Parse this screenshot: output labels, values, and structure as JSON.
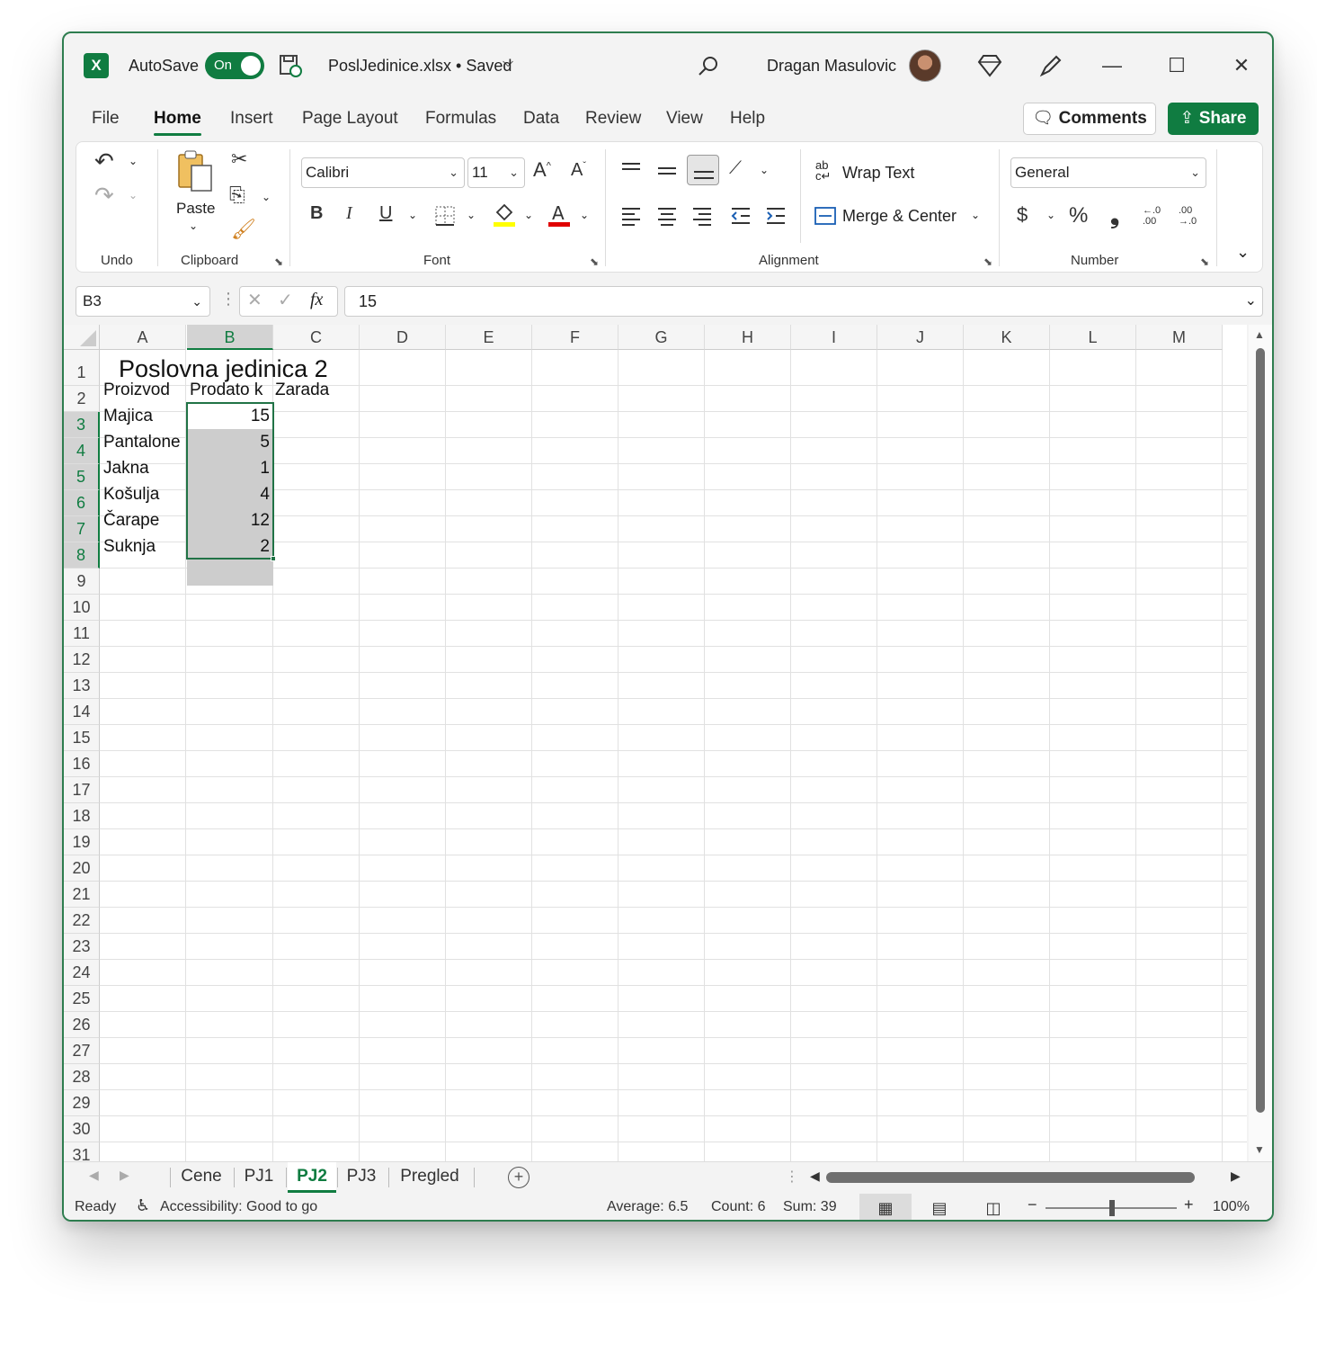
{
  "titlebar": {
    "autosave_label": "AutoSave",
    "autosave_state": "On",
    "file_title": "PoslJedinice.xlsx • Saved",
    "user_name": "Dragan Masulovic"
  },
  "menu": {
    "tabs": [
      "File",
      "Home",
      "Insert",
      "Page Layout",
      "Formulas",
      "Data",
      "Review",
      "View",
      "Help"
    ],
    "active": "Home",
    "comments_label": "Comments",
    "share_label": "Share"
  },
  "ribbon": {
    "groups": {
      "undo": "Undo",
      "clipboard": "Clipboard",
      "font": "Font",
      "alignment": "Alignment",
      "number": "Number"
    },
    "paste_label": "Paste",
    "font_name": "Calibri",
    "font_size": "11",
    "bold": "B",
    "italic": "I",
    "underline": "U",
    "wrap_text": "Wrap Text",
    "merge_center": "Merge & Center",
    "number_format": "General",
    "currency": "$",
    "percent": "%",
    "comma": "❟",
    "increase_decimal": "←.0 .00",
    "decrease_decimal": ".00 →.0"
  },
  "formula_bar": {
    "name_box": "B3",
    "fx": "fx",
    "value": "15"
  },
  "sheet": {
    "columns": [
      "A",
      "B",
      "C",
      "D",
      "E",
      "F",
      "G",
      "H",
      "I",
      "J",
      "K",
      "L",
      "M"
    ],
    "rows": [
      "1",
      "2",
      "3",
      "4",
      "5",
      "6",
      "7",
      "8",
      "9",
      "10",
      "11",
      "12",
      "13",
      "14",
      "15",
      "16",
      "17",
      "18",
      "19",
      "20",
      "21",
      "22",
      "23",
      "24",
      "25",
      "26",
      "27",
      "28",
      "29",
      "30",
      "31"
    ],
    "title": "Poslovna jedinica 2",
    "headers": {
      "a": "Proizvod",
      "b": "Prodato k",
      "c": "Zarada"
    },
    "data": [
      {
        "product": "Majica",
        "qty": "15"
      },
      {
        "product": "Pantalone",
        "qty": "5"
      },
      {
        "product": "Jakna",
        "qty": "1"
      },
      {
        "product": "Košulja",
        "qty": "4"
      },
      {
        "product": "Čarape",
        "qty": "12"
      },
      {
        "product": "Suknja",
        "qty": "2"
      }
    ]
  },
  "sheet_tabs": {
    "tabs": [
      "Cene",
      "PJ1",
      "PJ2",
      "PJ3",
      "Pregled"
    ],
    "active": "PJ2"
  },
  "status": {
    "ready": "Ready",
    "accessibility": "Accessibility: Good to go",
    "average": "Average: 6.5",
    "count": "Count: 6",
    "sum": "Sum: 39",
    "zoom": "100%"
  },
  "colors": {
    "accent": "#107c41",
    "selection": "#cdcdcd",
    "highlight_yellow": "#ffff00",
    "font_red": "#e00000"
  }
}
